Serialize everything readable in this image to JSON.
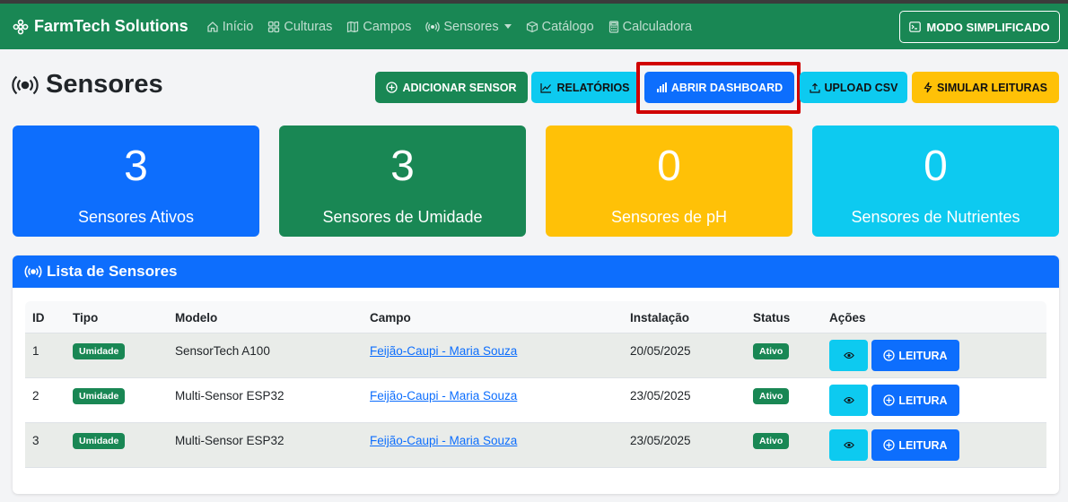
{
  "navbar": {
    "brand": "FarmTech Solutions",
    "links": [
      {
        "label": "Início",
        "icon": "house-icon"
      },
      {
        "label": "Culturas",
        "icon": "grid-icon"
      },
      {
        "label": "Campos",
        "icon": "map-icon"
      },
      {
        "label": "Sensores",
        "icon": "broadcast-icon"
      },
      {
        "label": "Catálogo",
        "icon": "box-icon"
      },
      {
        "label": "Calculadora",
        "icon": "calculator-icon"
      }
    ],
    "mode_button": "MODO SIMPLIFICADO"
  },
  "page": {
    "title": "Sensores",
    "actions": {
      "add": "ADICIONAR SENSOR",
      "reports": "RELATÓRIOS",
      "dashboard": "ABRIR DASHBOARD",
      "upload": "UPLOAD CSV",
      "simulate": "SIMULAR LEITURAS"
    }
  },
  "stats": [
    {
      "value": "3",
      "label": "Sensores Ativos",
      "color": "#0d6efd"
    },
    {
      "value": "3",
      "label": "Sensores de Umidade",
      "color": "#198754"
    },
    {
      "value": "0",
      "label": "Sensores de pH",
      "color": "#ffc107"
    },
    {
      "value": "0",
      "label": "Sensores de Nutrientes",
      "color": "#0dcaf0"
    }
  ],
  "sensor_list": {
    "title": "Lista de Sensores",
    "columns": [
      "ID",
      "Tipo",
      "Modelo",
      "Campo",
      "Instalação",
      "Status",
      "Ações"
    ],
    "rows": [
      {
        "id": "1",
        "tipo": "Umidade",
        "modelo": "SensorTech A100",
        "campo": "Feijão-Caupi - Maria Souza",
        "instalacao": "20/05/2025",
        "status": "Ativo"
      },
      {
        "id": "2",
        "tipo": "Umidade",
        "modelo": "Multi-Sensor ESP32",
        "campo": "Feijão-Caupi - Maria Souza",
        "instalacao": "23/05/2025",
        "status": "Ativo"
      },
      {
        "id": "3",
        "tipo": "Umidade",
        "modelo": "Multi-Sensor ESP32",
        "campo": "Feijão-Caupi - Maria Souza",
        "instalacao": "23/05/2025",
        "status": "Ativo"
      }
    ],
    "read_button": "LEITURA"
  }
}
